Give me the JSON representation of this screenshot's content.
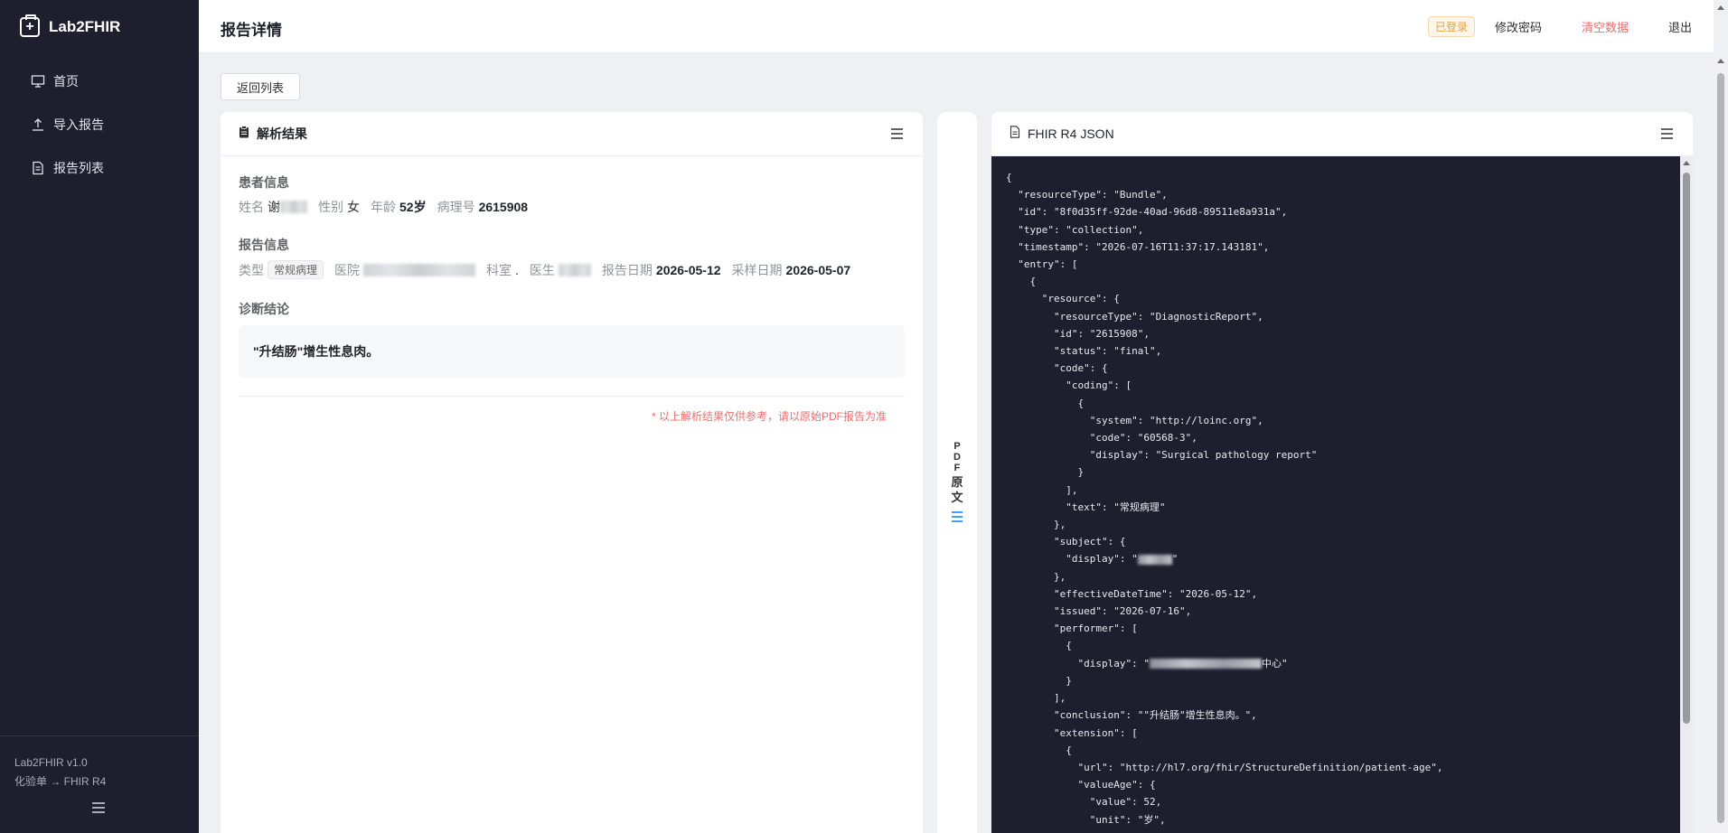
{
  "app": {
    "name": "Lab2FHIR",
    "version": "Lab2FHIR v1.0",
    "tagline": "化验单 → FHIR R4"
  },
  "sidebar": {
    "items": [
      {
        "label": "首页",
        "icon": "monitor-icon"
      },
      {
        "label": "导入报告",
        "icon": "upload-icon"
      },
      {
        "label": "报告列表",
        "icon": "document-icon"
      }
    ]
  },
  "header": {
    "title": "报告详情",
    "status_badge": "已登录",
    "change_password": "修改密码",
    "clear_data": "清空数据",
    "logout": "退出"
  },
  "back_button": "返回列表",
  "parse_result": {
    "title": "解析结果",
    "patient_section": "患者信息",
    "name_label": "姓名",
    "name_value": "谢",
    "gender_label": "性别",
    "gender_value": "女",
    "age_label": "年龄",
    "age_value": "52岁",
    "pathology_no_label": "病理号",
    "pathology_no_value": "2615908",
    "report_section": "报告信息",
    "type_label": "类型",
    "type_value": "常规病理",
    "hospital_label": "医院",
    "department_label": "科室",
    "department_value": ".",
    "doctor_label": "医生",
    "report_date_label": "报告日期",
    "report_date_value": "2026-05-12",
    "sample_date_label": "采样日期",
    "sample_date_value": "2026-05-07",
    "diagnosis_section": "诊断结论",
    "diagnosis_text": "\"升结肠\"增生性息肉。",
    "disclaimer": "* 以上解析结果仅供参考，请以原始PDF报告为准"
  },
  "pdf_tab": {
    "label": "PDF 原文"
  },
  "fhir_json": {
    "title": "FHIR R4 JSON",
    "lines": [
      "{",
      "  \"resourceType\": \"Bundle\",",
      "  \"id\": \"8f0d35ff-92de-40ad-96d8-89511e8a931a\",",
      "  \"type\": \"collection\",",
      "  \"timestamp\": \"2026-07-16T11:37:17.143181\",",
      "  \"entry\": [",
      "    {",
      "      \"resource\": {",
      "        \"resourceType\": \"DiagnosticReport\",",
      "        \"id\": \"2615908\",",
      "        \"status\": \"final\",",
      "        \"code\": {",
      "          \"coding\": [",
      "            {",
      "              \"system\": \"http://loinc.org\",",
      "              \"code\": \"60568-3\",",
      "              \"display\": \"Surgical pathology report\"",
      "            }",
      "          ],",
      "          \"text\": \"常规病理\"",
      "        },",
      "        \"subject\": {",
      "          \"display\": \"",
      "        },",
      "        \"effectiveDateTime\": \"2026-05-12\",",
      "        \"issued\": \"2026-07-16\",",
      "        \"performer\": [",
      "          {",
      "            \"display\": \"",
      "          }",
      "        ],",
      "        \"conclusion\": \"\"升结肠\"增生性息肉。\",",
      "        \"extension\": [",
      "          {",
      "            \"url\": \"http://hl7.org/fhir/StructureDefinition/patient-age\",",
      "            \"valueAge\": {",
      "              \"value\": 52,",
      "              \"unit\": \"岁\","
    ],
    "performer_suffix": "中心\""
  }
}
